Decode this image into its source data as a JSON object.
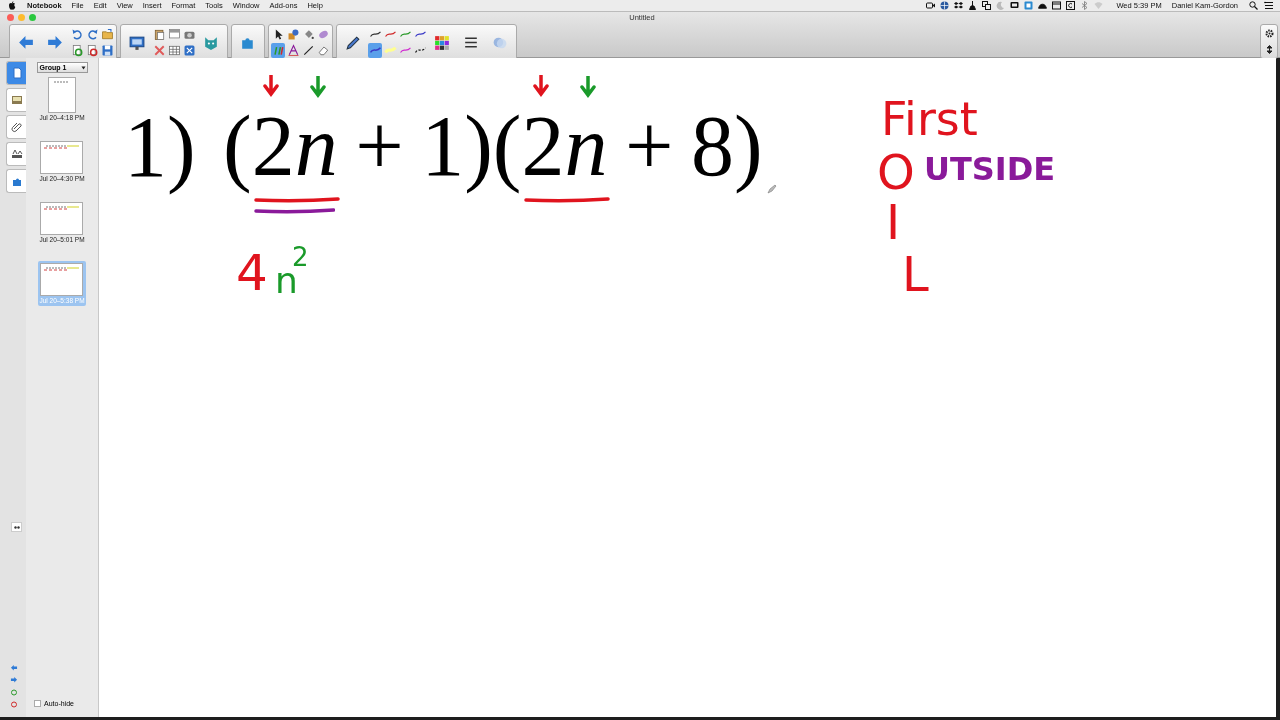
{
  "menubar": {
    "app": "Notebook",
    "menus": [
      "File",
      "Edit",
      "View",
      "Insert",
      "Format",
      "Tools",
      "Window",
      "Add-ons",
      "Help"
    ],
    "clock": "Wed 5:39 PM",
    "user": "Daniel Kam-Gordon"
  },
  "window": {
    "title": "Untitled"
  },
  "side_tabs": [
    {
      "kind": "pages",
      "selected": true
    },
    {
      "kind": "gallery",
      "selected": false
    },
    {
      "kind": "attachments",
      "selected": false
    },
    {
      "kind": "properties",
      "selected": false
    },
    {
      "kind": "addons",
      "selected": false
    }
  ],
  "page_sorter": {
    "group": "Group 1",
    "pages": [
      {
        "label": "Jul 20–4:18 PM",
        "selected": false
      },
      {
        "label": "Jul 20–4:30 PM",
        "selected": false
      },
      {
        "label": "Jul 20–5:01 PM",
        "selected": false
      },
      {
        "label": "Jul 20–5:38 PM",
        "selected": true
      }
    ]
  },
  "auto_hide": {
    "label": "Auto-hide",
    "checked": false
  },
  "canvas": {
    "problem_number": "1)",
    "expression": [
      {
        "kind": "plain",
        "text": "(2"
      },
      {
        "kind": "variable",
        "text": "n"
      },
      {
        "kind": "plain",
        "text": " + 1)(2"
      },
      {
        "kind": "variable",
        "text": "n"
      },
      {
        "kind": "plain",
        "text": " + 8)"
      }
    ],
    "ink": [
      {
        "text": "First",
        "color": "#e0141e"
      },
      {
        "text": "O",
        "color": "#e0141e"
      },
      {
        "text": "UTSIDE",
        "color": "#8a1a9a"
      },
      {
        "text": "I",
        "color": "#e0141e"
      },
      {
        "text": "4",
        "color": "#e0141e"
      },
      {
        "text": "n",
        "color": "#1a9a2a"
      },
      {
        "text": "2",
        "color": "#1a9a2a"
      },
      {
        "text": "L",
        "color": "#e0141e"
      }
    ]
  }
}
